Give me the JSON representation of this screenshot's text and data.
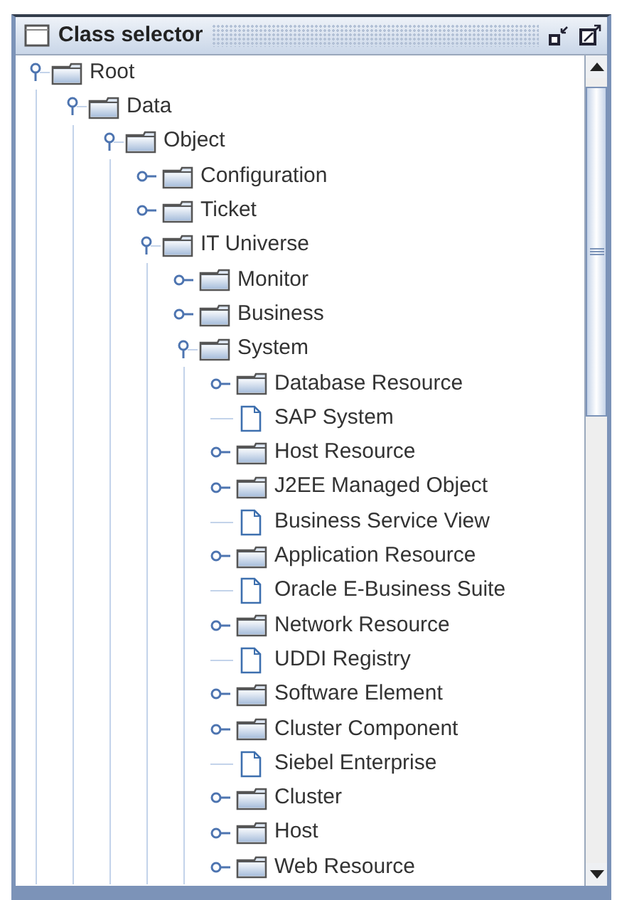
{
  "window": {
    "title": "Class selector"
  },
  "tree": [
    {
      "label": "Root",
      "kind": "folder",
      "expanded": true,
      "children": [
        {
          "label": "Data",
          "kind": "folder",
          "expanded": true,
          "children": [
            {
              "label": "Object",
              "kind": "folder",
              "expanded": true,
              "children": [
                {
                  "label": "Configuration",
                  "kind": "folder",
                  "expanded": false
                },
                {
                  "label": "Ticket",
                  "kind": "folder",
                  "expanded": false
                },
                {
                  "label": "IT Universe",
                  "kind": "folder",
                  "expanded": true,
                  "children": [
                    {
                      "label": "Monitor",
                      "kind": "folder",
                      "expanded": false
                    },
                    {
                      "label": "Business",
                      "kind": "folder",
                      "expanded": false
                    },
                    {
                      "label": "System",
                      "kind": "folder",
                      "expanded": true,
                      "children": [
                        {
                          "label": "Database Resource",
                          "kind": "folder",
                          "expanded": false
                        },
                        {
                          "label": "SAP System",
                          "kind": "leaf"
                        },
                        {
                          "label": "Host Resource",
                          "kind": "folder",
                          "expanded": false
                        },
                        {
                          "label": "J2EE Managed Object",
                          "kind": "folder",
                          "expanded": false
                        },
                        {
                          "label": "Business Service View",
                          "kind": "leaf"
                        },
                        {
                          "label": "Application Resource",
                          "kind": "folder",
                          "expanded": false
                        },
                        {
                          "label": "Oracle E-Business Suite",
                          "kind": "leaf"
                        },
                        {
                          "label": "Network Resource",
                          "kind": "folder",
                          "expanded": false
                        },
                        {
                          "label": "UDDI Registry",
                          "kind": "leaf"
                        },
                        {
                          "label": "Software Element",
                          "kind": "folder",
                          "expanded": false
                        },
                        {
                          "label": "Cluster Component",
                          "kind": "folder",
                          "expanded": false
                        },
                        {
                          "label": "Siebel Enterprise",
                          "kind": "leaf"
                        },
                        {
                          "label": "Cluster",
                          "kind": "folder",
                          "expanded": false
                        },
                        {
                          "label": "Host",
                          "kind": "folder",
                          "expanded": false
                        },
                        {
                          "label": "Web Resource",
                          "kind": "folder",
                          "expanded": false
                        }
                      ]
                    }
                  ]
                }
              ]
            }
          ]
        }
      ]
    }
  ]
}
